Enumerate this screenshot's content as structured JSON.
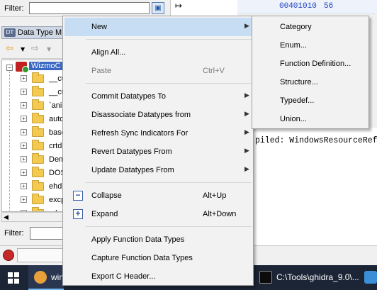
{
  "background": {
    "filter_label": "Filter:",
    "listing_address": "00401010",
    "listing_value": "56",
    "data_type_manager_title": "Data Type M",
    "root_label": "WizmoC",
    "tree_items": [
      "__cu",
      "__cu",
      "`ani",
      "auto",
      "base",
      "crtd",
      "Dem",
      "DOS",
      "ehd",
      "excp",
      "mbs"
    ],
    "console_text": "piled: WindowsResourceRefe",
    "bottom_filter_label": "Filter:"
  },
  "context_menu": {
    "items": [
      {
        "label": "New",
        "submenu": true,
        "highlighted": true
      },
      {
        "label": "Align All..."
      },
      {
        "label": "Paste",
        "shortcut": "Ctrl+V",
        "disabled": true
      },
      {
        "label": "Commit Datatypes To",
        "submenu": true
      },
      {
        "label": "Disassociate Datatypes from",
        "submenu": true
      },
      {
        "label": "Refresh Sync Indicators For",
        "submenu": true
      },
      {
        "label": "Revert Datatypes From",
        "submenu": true
      },
      {
        "label": "Update Datatypes From",
        "submenu": true
      },
      {
        "label": "Collapse",
        "shortcut": "Alt+Up",
        "icon": "collapse-icon"
      },
      {
        "label": "Expand",
        "shortcut": "Alt+Down",
        "icon": "expand-icon"
      },
      {
        "label": "Apply Function Data Types"
      },
      {
        "label": "Capture Function Data Types"
      },
      {
        "label": "Export C Header..."
      }
    ]
  },
  "new_submenu": {
    "items": [
      "Category",
      "Enum...",
      "Function Definition...",
      "Structure...",
      "Typedef...",
      "Union..."
    ]
  },
  "taskbar": {
    "items": [
      {
        "label": "win",
        "icon": "ghidra-icon"
      },
      {
        "label": "C:\\Tools\\ghidra_9.0\\...",
        "icon": "terminal-icon"
      }
    ]
  },
  "colors": {
    "menu_highlight": "#c7ddf3",
    "selection": "#3b67c2",
    "taskbar": "#1c2536"
  }
}
